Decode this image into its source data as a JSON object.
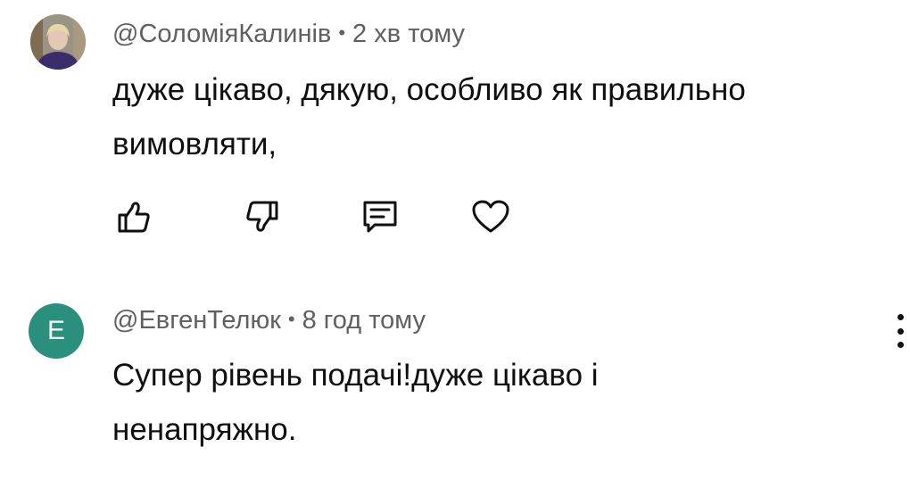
{
  "comments": [
    {
      "author": "@СоломіяКалинів",
      "separator": "•",
      "time": "2 хв тому",
      "text_line1": "дуже цікаво, дякую, особливо як правильно",
      "text_line2": "вимовляти,",
      "avatar_type": "photo"
    },
    {
      "author": "@ЕвгенТелюк",
      "separator": "•",
      "time": "8 год тому",
      "avatar_letter": "E",
      "avatar_color": "#2a8f7c",
      "text_line1": "Супер рівень подачі!дуже цікаво і",
      "text_line2": "ненапряжно."
    }
  ],
  "action_icons": [
    "thumbs-up-icon",
    "thumbs-down-icon",
    "reply-icon",
    "heart-icon"
  ]
}
